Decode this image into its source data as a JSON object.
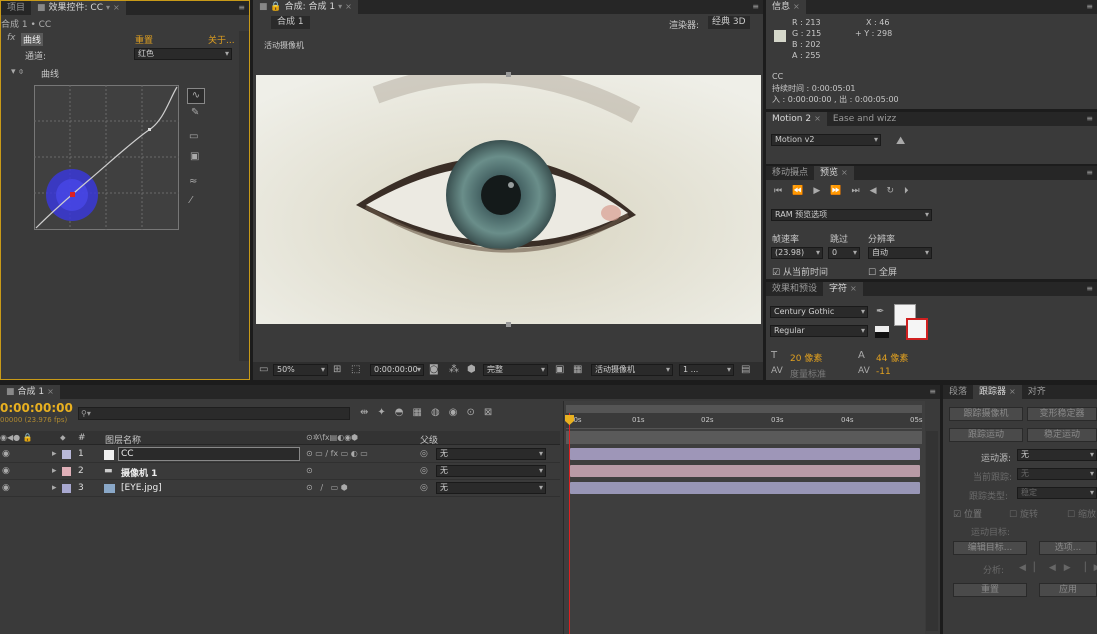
{
  "top_left": {
    "tabs": [
      "项目",
      "效果控件: CC"
    ],
    "layer_path": "合成 1 • CC",
    "fx_label": "fx",
    "effect_name": "曲线",
    "reset": "重置",
    "about": "关于...",
    "channel_label": "通道:",
    "channel_value": "红色",
    "curves_label": "曲线"
  },
  "composition": {
    "tab_label": "合成: 合成 1",
    "sub_tab": "合成 1",
    "renderer_label": "渲染器:",
    "renderer_value": "经典 3D",
    "camera_label": "活动摄像机",
    "zoom": "50%",
    "timecode": "0:00:00:00",
    "quality": "完整",
    "view": "活动摄像机",
    "views_count": "1 ..."
  },
  "info": {
    "tab": "信息",
    "r": "R : 213",
    "g": "G : 215",
    "b": "B : 202",
    "a": "A : 255",
    "x": "X : 46",
    "y": "+ Y : 298",
    "layer": "CC",
    "duration": "持续时间 : 0:00:05:01",
    "inout": "入 : 0:00:00:00 , 出 : 0:00:05:00"
  },
  "motion": {
    "tabs": [
      "Motion 2",
      "Ease and wizz"
    ],
    "preset": "Motion v2"
  },
  "preview": {
    "tabs": [
      "移动摄点",
      "预览"
    ],
    "ram_label": "RAM 预览选项",
    "framerate_label": "帧速率",
    "skip_label": "跳过",
    "resolution_label": "分辨率",
    "framerate_value": "(23.98)",
    "skip_value": "0",
    "resolution_value": "自动",
    "from_current": "从当前时间",
    "fullscreen": "全屏"
  },
  "character": {
    "tabs": [
      "效果和预设",
      "字符"
    ],
    "font": "Century Gothic",
    "style": "Regular",
    "size": "20 像素",
    "leading": "44 像素",
    "kerning_label": "度量标准",
    "tracking": "-11"
  },
  "timeline": {
    "tab": "合成 1",
    "timecode": "0:00:00:00",
    "fps": "00000 (23.976 fps)",
    "search_placeholder": "",
    "col_num": "#",
    "col_name": "图层名称",
    "col_parent": "父级",
    "ruler": [
      "00s",
      "01s",
      "02s",
      "03s",
      "04s",
      "05s"
    ],
    "layers": [
      {
        "num": "1",
        "name": "CC",
        "parent": "无",
        "color": "#b8b8d8"
      },
      {
        "num": "2",
        "name": "摄像机 1",
        "parent": "无",
        "color": "#e0b0b8"
      },
      {
        "num": "3",
        "name": "[EYE.jpg]",
        "parent": "无",
        "color": "#a8a8d0"
      }
    ],
    "bar_colors": [
      "#9e96b8",
      "#b89aa6",
      "#9896b6"
    ]
  },
  "tracker": {
    "tabs": [
      "段落",
      "跟踪器",
      "对齐"
    ],
    "track_camera": "跟踪摄像机",
    "warp_stabilizer": "变形稳定器",
    "track_motion": "跟踪运动",
    "stabilize_motion": "稳定运动",
    "motion_source_label": "运动源:",
    "motion_source_value": "无",
    "current_track_label": "当前跟踪:",
    "current_track_value": "无",
    "track_type_label": "跟踪类型:",
    "track_type_value": "稳定",
    "position": "位置",
    "rotation": "旋转",
    "scale": "缩放",
    "motion_target": "运动目标:",
    "edit_target": "编辑目标...",
    "options": "选项...",
    "analyze": "分析:",
    "reset": "重置",
    "apply": "应用"
  }
}
